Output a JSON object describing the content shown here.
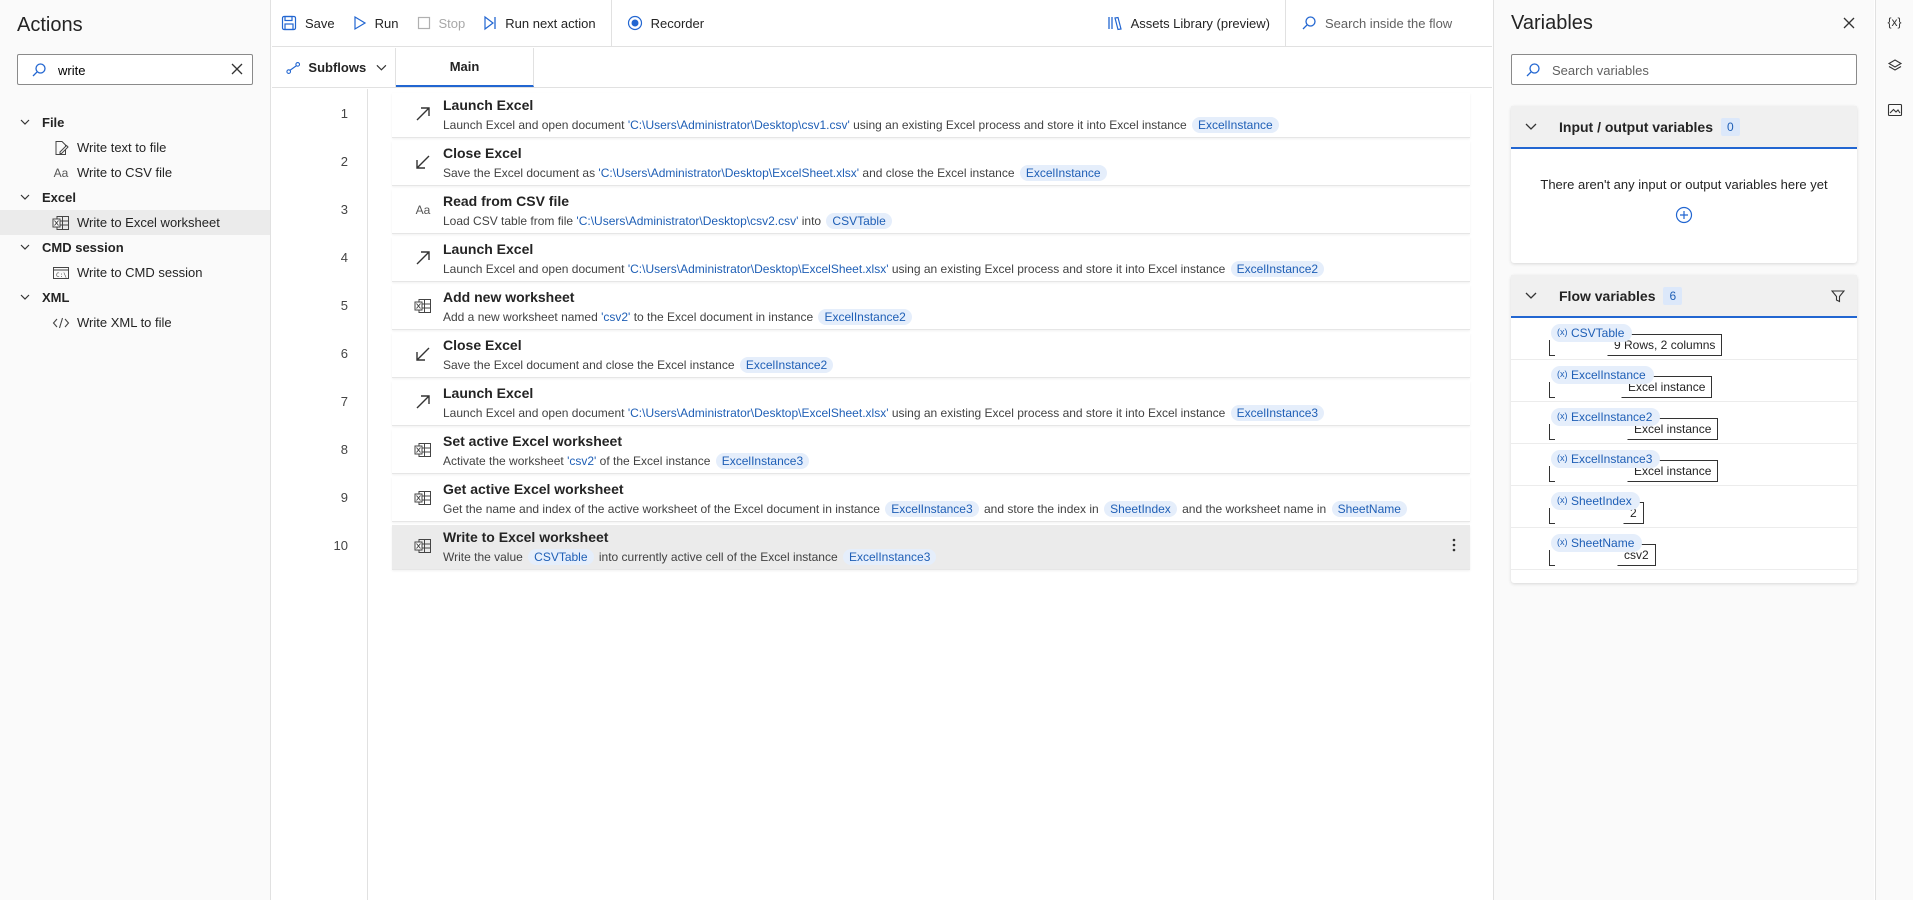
{
  "actions_panel": {
    "title": "Actions",
    "search_value": "write",
    "categories": [
      {
        "label": "File",
        "items": [
          {
            "label": "Write text to file",
            "icon": "file-edit-icon"
          },
          {
            "label": "Write to CSV file",
            "icon": "text-aa-icon"
          }
        ]
      },
      {
        "label": "Excel",
        "items": [
          {
            "label": "Write to Excel worksheet",
            "icon": "excel-sheet-icon"
          }
        ]
      },
      {
        "label": "CMD session",
        "items": [
          {
            "label": "Write to CMD session",
            "icon": "cmd-icon"
          }
        ]
      },
      {
        "label": "XML",
        "items": [
          {
            "label": "Write XML to file",
            "icon": "xml-code-icon"
          }
        ]
      }
    ]
  },
  "toolbar": {
    "save": "Save",
    "run": "Run",
    "stop": "Stop",
    "run_next": "Run next action",
    "recorder": "Recorder",
    "assets": "Assets Library (preview)",
    "search_flow": "Search inside the flow"
  },
  "tabs": {
    "subflows": "Subflows",
    "main": "Main"
  },
  "steps": [
    {
      "n": "1",
      "icon": "launch-arrow-icon",
      "title": "Launch Excel",
      "desc": [
        [
          "t",
          "Launch Excel and open document "
        ],
        [
          "l",
          "'C:\\Users\\Administrator\\Desktop\\csv1.csv'"
        ],
        [
          "t",
          " using an existing Excel process and store it into Excel instance "
        ],
        [
          "p",
          "ExcelInstance"
        ]
      ]
    },
    {
      "n": "2",
      "icon": "close-arrow-icon",
      "title": "Close Excel",
      "desc": [
        [
          "t",
          "Save the Excel document as "
        ],
        [
          "l",
          "'C:\\Users\\Administrator\\Desktop\\ExcelSheet.xlsx'"
        ],
        [
          "t",
          " and close the Excel instance "
        ],
        [
          "p",
          "ExcelInstance"
        ]
      ]
    },
    {
      "n": "3",
      "icon": "text-aa-icon",
      "title": "Read from CSV file",
      "desc": [
        [
          "t",
          "Load CSV table from file "
        ],
        [
          "l",
          "'C:\\Users\\Administrator\\Desktop\\csv2.csv'"
        ],
        [
          "t",
          " into "
        ],
        [
          "p",
          "CSVTable"
        ]
      ]
    },
    {
      "n": "4",
      "icon": "launch-arrow-icon",
      "title": "Launch Excel",
      "desc": [
        [
          "t",
          "Launch Excel and open document "
        ],
        [
          "l",
          "'C:\\Users\\Administrator\\Desktop\\ExcelSheet.xlsx'"
        ],
        [
          "t",
          " using an existing Excel process and store it into Excel instance "
        ],
        [
          "p",
          "ExcelInstance2"
        ]
      ]
    },
    {
      "n": "5",
      "icon": "excel-sheet-icon",
      "title": "Add new worksheet",
      "desc": [
        [
          "t",
          "Add a new worksheet named "
        ],
        [
          "l",
          "'csv2'"
        ],
        [
          "t",
          " to the Excel document in instance "
        ],
        [
          "p",
          "ExcelInstance2"
        ]
      ]
    },
    {
      "n": "6",
      "icon": "close-arrow-icon",
      "title": "Close Excel",
      "desc": [
        [
          "t",
          "Save the Excel document and close the Excel instance "
        ],
        [
          "p",
          "ExcelInstance2"
        ]
      ]
    },
    {
      "n": "7",
      "icon": "launch-arrow-icon",
      "title": "Launch Excel",
      "desc": [
        [
          "t",
          "Launch Excel and open document "
        ],
        [
          "l",
          "'C:\\Users\\Administrator\\Desktop\\ExcelSheet.xlsx'"
        ],
        [
          "t",
          " using an existing Excel process and store it into Excel instance "
        ],
        [
          "p",
          "ExcelInstance3"
        ]
      ]
    },
    {
      "n": "8",
      "icon": "excel-sheet-icon",
      "title": "Set active Excel worksheet",
      "desc": [
        [
          "t",
          "Activate the worksheet "
        ],
        [
          "l",
          "'csv2'"
        ],
        [
          "t",
          " of the Excel instance "
        ],
        [
          "p",
          "ExcelInstance3"
        ]
      ]
    },
    {
      "n": "9",
      "icon": "excel-sheet-icon",
      "title": "Get active Excel worksheet",
      "desc": [
        [
          "t",
          "Get the name and index of the active worksheet of the Excel document in instance "
        ],
        [
          "p",
          "ExcelInstance3"
        ],
        [
          "t",
          " and store the index in "
        ],
        [
          "p",
          "SheetIndex"
        ],
        [
          "t",
          " and the worksheet name in "
        ],
        [
          "p",
          "SheetName"
        ]
      ]
    },
    {
      "n": "10",
      "icon": "excel-sheet-icon",
      "title": "Write to Excel worksheet",
      "selected": true,
      "desc": [
        [
          "t",
          "Write the value "
        ],
        [
          "p",
          "CSVTable"
        ],
        [
          "t",
          " into currently active cell of the Excel instance "
        ],
        [
          "p",
          "ExcelInstance3"
        ]
      ]
    }
  ],
  "variables_panel": {
    "title": "Variables",
    "search_placeholder": "Search variables",
    "io": {
      "label": "Input / output variables",
      "count": "0",
      "empty": "There aren't any input or output variables here yet"
    },
    "flow": {
      "label": "Flow variables",
      "count": "6"
    },
    "flow_vars": [
      {
        "name": "CSVTable",
        "value": "9 Rows, 2 columns"
      },
      {
        "name": "ExcelInstance",
        "value": "Excel instance"
      },
      {
        "name": "ExcelInstance2",
        "value": "Excel instance"
      },
      {
        "name": "ExcelInstance3",
        "value": "Excel instance"
      },
      {
        "name": "SheetIndex",
        "value": "2"
      },
      {
        "name": "SheetName",
        "value": "csv2"
      }
    ]
  },
  "rail": {
    "variables_icon_text": "{x}"
  },
  "colors": {
    "accent": "#2266d1",
    "literal": "#1f5fb6",
    "pill_bg": "#e5eefb"
  }
}
